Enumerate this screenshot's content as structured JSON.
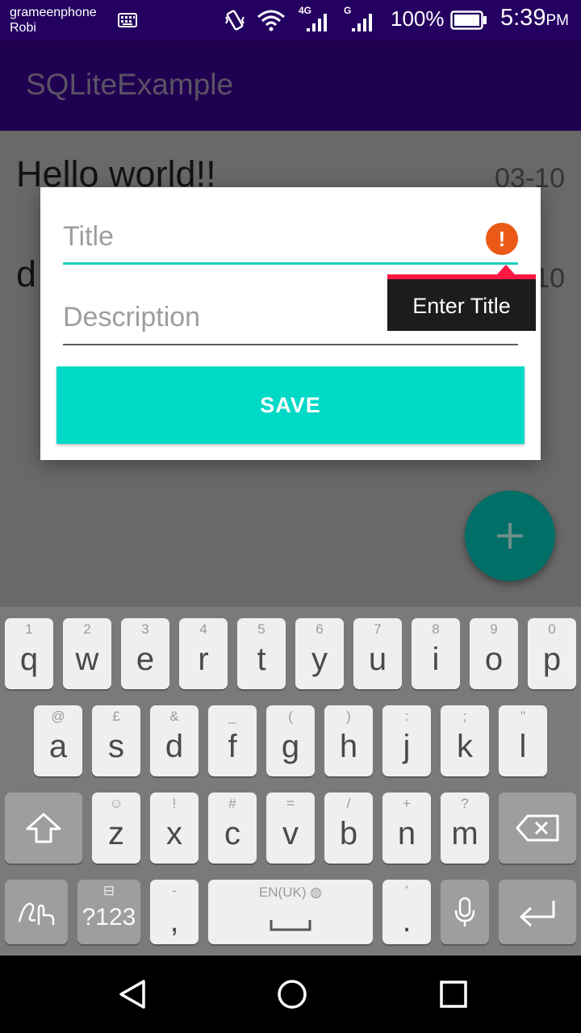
{
  "status_bar": {
    "carrier_1": "grameenphone",
    "carrier_2": "Robi",
    "network_1": "4G",
    "network_2": "G",
    "battery": "100%",
    "time": "5:39",
    "time_suffix": "PM",
    "icons": [
      "keyboard-icon",
      "vibrate-icon",
      "wifi-icon",
      "signal-icon",
      "signal-icon",
      "battery-icon"
    ]
  },
  "app_bar": {
    "title": "SQLiteExample"
  },
  "notes": [
    {
      "title": "Hello world!!",
      "date": "03-10"
    },
    {
      "title": "d",
      "date": "10"
    }
  ],
  "dialog": {
    "title_placeholder": "Title",
    "description_placeholder": "Description",
    "save_label": "SAVE",
    "error_icon": "!",
    "error_message": "Enter Title"
  },
  "fab": {
    "icon": "plus-icon",
    "label": "+"
  },
  "keyboard": {
    "row1": [
      {
        "hint": "1",
        "key": "q"
      },
      {
        "hint": "2",
        "key": "w"
      },
      {
        "hint": "3",
        "key": "e"
      },
      {
        "hint": "4",
        "key": "r"
      },
      {
        "hint": "5",
        "key": "t"
      },
      {
        "hint": "6",
        "key": "y"
      },
      {
        "hint": "7",
        "key": "u"
      },
      {
        "hint": "8",
        "key": "i"
      },
      {
        "hint": "9",
        "key": "o"
      },
      {
        "hint": "0",
        "key": "p"
      }
    ],
    "row2": [
      {
        "hint": "@",
        "key": "a"
      },
      {
        "hint": "£",
        "key": "s"
      },
      {
        "hint": "&",
        "key": "d"
      },
      {
        "hint": "_",
        "key": "f"
      },
      {
        "hint": "(",
        "key": "g"
      },
      {
        "hint": ")",
        "key": "h"
      },
      {
        "hint": ":",
        "key": "j"
      },
      {
        "hint": ";",
        "key": "k"
      },
      {
        "hint": "\"",
        "key": "l"
      }
    ],
    "row3": [
      {
        "hint": "☺",
        "key": "z"
      },
      {
        "hint": "!",
        "key": "x"
      },
      {
        "hint": "#",
        "key": "c"
      },
      {
        "hint": "=",
        "key": "v"
      },
      {
        "hint": "/",
        "key": "b"
      },
      {
        "hint": "+",
        "key": "n"
      },
      {
        "hint": "?",
        "key": "m"
      }
    ],
    "symbols_label": "?123",
    "comma_hint": "-",
    "comma": ",",
    "space_hint": "EN(UK)",
    "period_hint": "'",
    "period": "."
  },
  "nav_bar": {
    "icons": [
      "back-icon",
      "home-icon",
      "recents-icon"
    ]
  }
}
